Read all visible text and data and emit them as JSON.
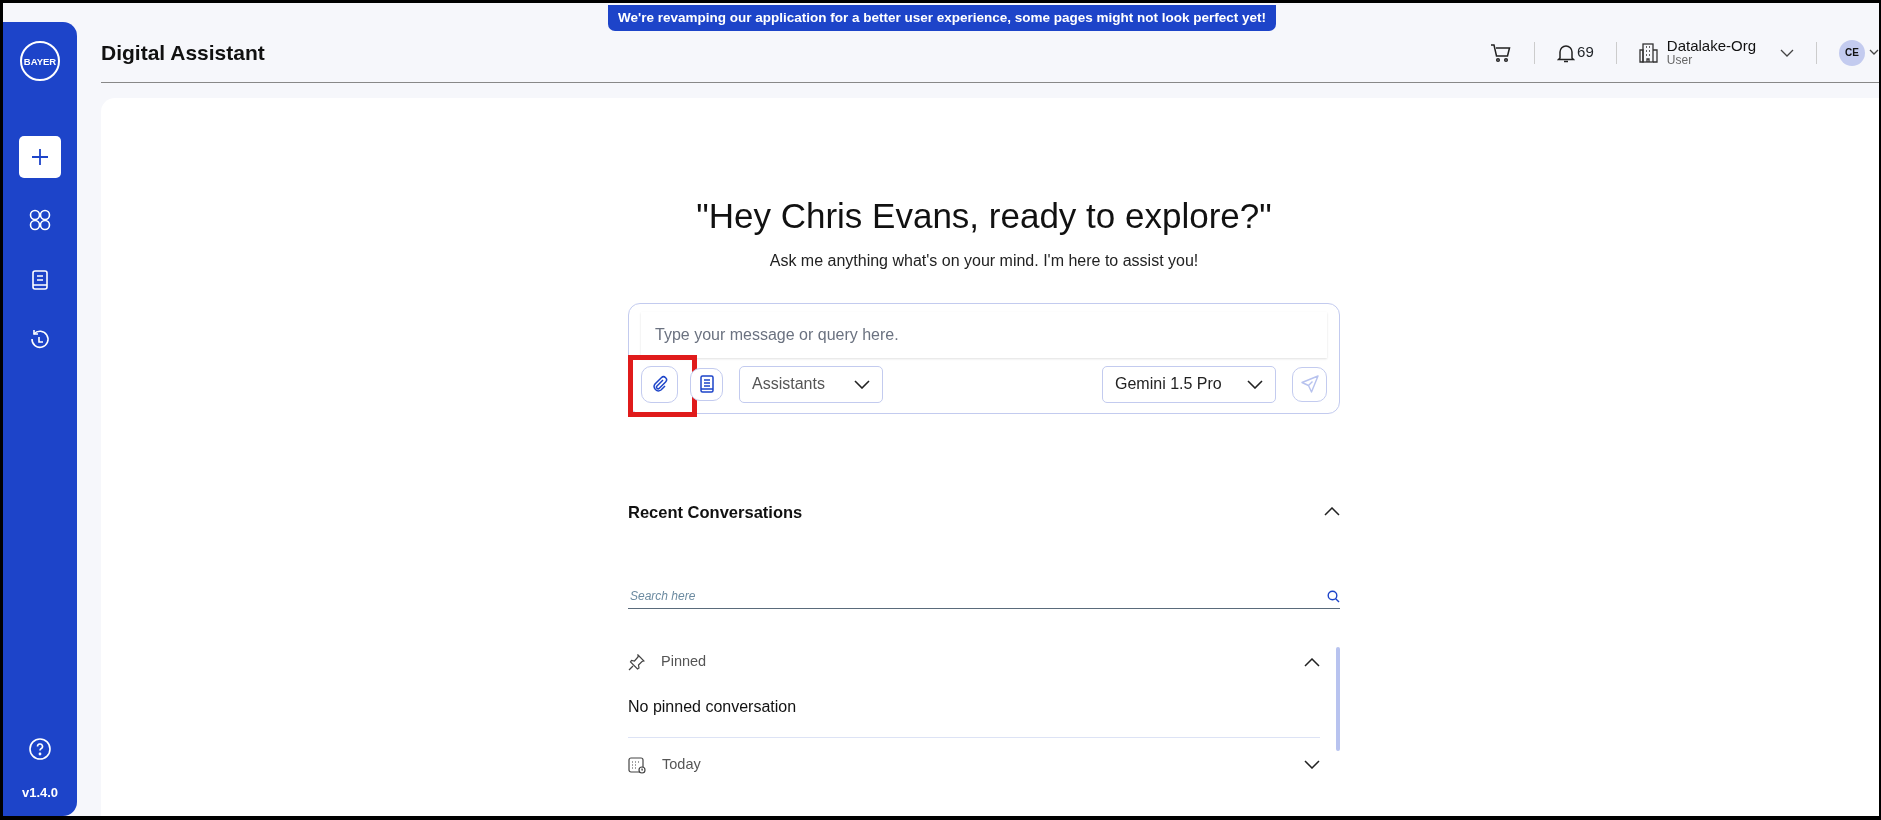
{
  "banner": "We're revamping our application for a better user experience, some pages might not look perfect yet!",
  "header": {
    "title": "Digital Assistant",
    "notifications": "69",
    "org": "Datalake-Org",
    "role": "User",
    "avatar": "CE"
  },
  "sidebar": {
    "logo": "BAYER",
    "version": "v1.4.0"
  },
  "greeting": {
    "title": "\"Hey Chris Evans, ready to explore?\"",
    "subtitle": "Ask me anything what's on your mind. I'm here to assist you!"
  },
  "composer": {
    "placeholder": "Type your message or query here.",
    "attach_highlighted": true,
    "assistants": "Assistants",
    "model": "Gemini 1.5 Pro",
    "send_disabled": true
  },
  "recent": {
    "title": "Recent Conversations",
    "expanded": true,
    "search_placeholder": "Search here",
    "groups": [
      {
        "kind": "pinned",
        "label": "Pinned",
        "expanded": true,
        "empty_text": "No pinned conversation"
      },
      {
        "kind": "today",
        "label": "Today",
        "expanded": false
      }
    ]
  }
}
